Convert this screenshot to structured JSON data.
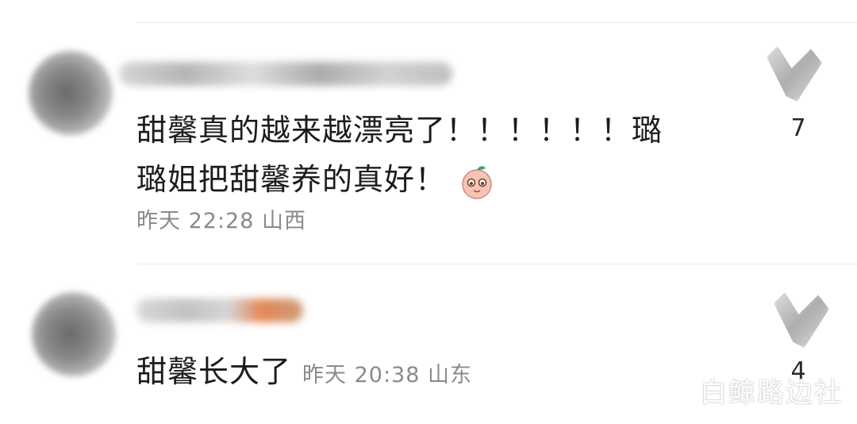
{
  "comments": [
    {
      "text_line1": "甜馨真的越来越漂亮了！！！！！！璐",
      "text_line2": "璐姐把甜馨养的真好！",
      "meta": "昨天 22:28 山西",
      "likes": "7",
      "emoji": "peach-face-emoji"
    },
    {
      "text": "甜馨长大了",
      "meta": "昨天 20:38 山东",
      "likes": "4"
    }
  ],
  "watermark": "白鲸路边社"
}
